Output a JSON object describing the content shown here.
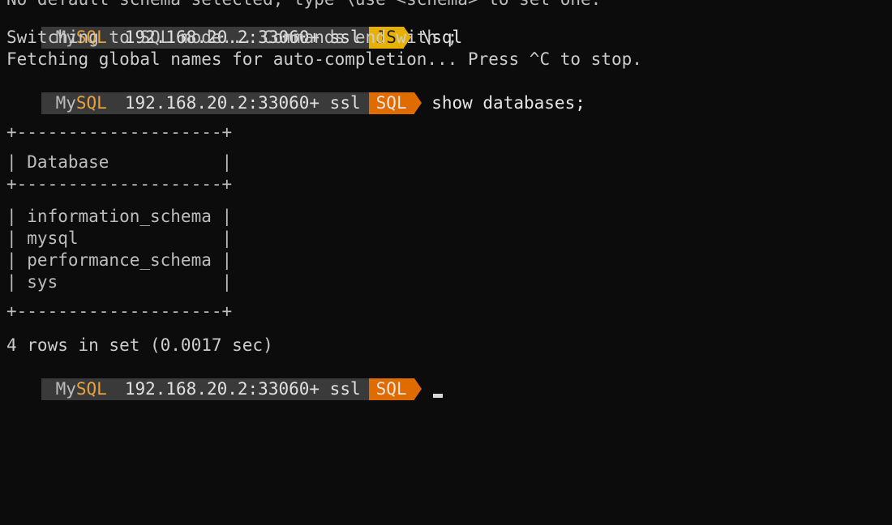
{
  "terminal": {
    "clipped_line": "No default schema selected; type \\use <schema> to set one.",
    "prompt_brand_prefix": "My",
    "prompt_brand_suffix": "SQL",
    "prompt_host": "192.168.20.2:33060+ ssl",
    "mode_js": "JS",
    "mode_sql": "SQL",
    "prompt_chevron": ">",
    "cmd_1": "\\sql",
    "output_1": "Switching to SQL mode... Commands end with ;",
    "output_2": "Fetching global names for auto-completion... Press ^C to stop.",
    "cmd_2": "show databases;",
    "table": {
      "border": "+--------------------+",
      "header_row": "| Database           |",
      "rows": [
        "| information_schema |",
        "| mysql              |",
        "| performance_schema |",
        "| sys                |"
      ]
    },
    "summary": "4 rows in set (0.0017 sec)"
  },
  "colors": {
    "background": "#0c0c0c",
    "js_mode": "#e8b100",
    "sql_mode": "#e06c00",
    "prompt_segment": "#3a3a3a"
  }
}
